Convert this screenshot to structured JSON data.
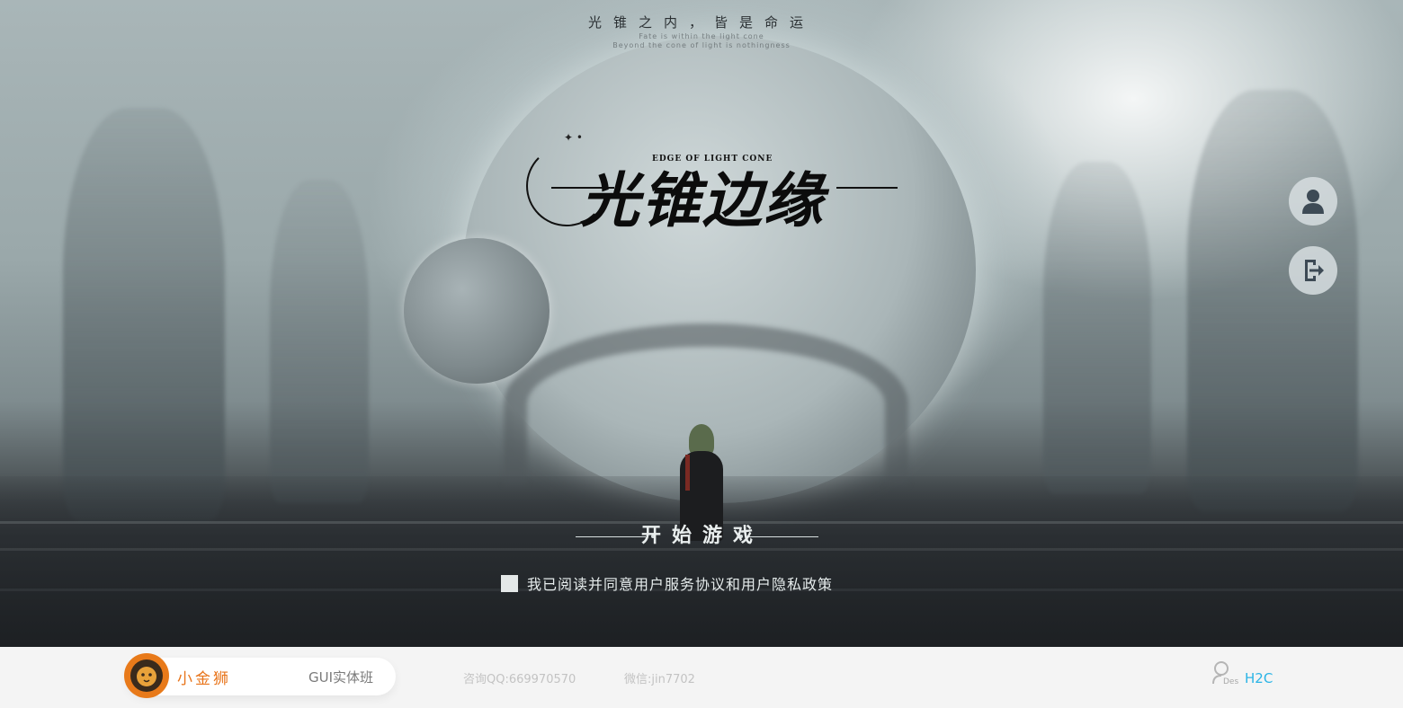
{
  "header": {
    "slogan": "光锥之内，皆是命运",
    "sub_line_1": "Fate is within the light cone",
    "sub_line_2": "Beyond the cone of light is nothingness"
  },
  "logo": {
    "title_cn": "光锥边缘",
    "title_en": "EDGE OF LIGHT CONE"
  },
  "side_buttons": {
    "account_icon": "user-silhouette-icon",
    "exit_icon": "exit-door-icon"
  },
  "start": {
    "label": "开始游戏"
  },
  "agreement": {
    "checked": false,
    "text": "我已阅读并同意用户服务协议和用户隐私政策"
  },
  "footer": {
    "brand_name": "小金狮",
    "course": "GUI实体班",
    "qq": "咨询QQ:669970570",
    "wechat": "微信:jin7702",
    "badge_small": "Des",
    "badge_text": "H2C"
  },
  "colors": {
    "brand_orange": "#e8741a",
    "h2c_blue": "#2ab4e6"
  }
}
